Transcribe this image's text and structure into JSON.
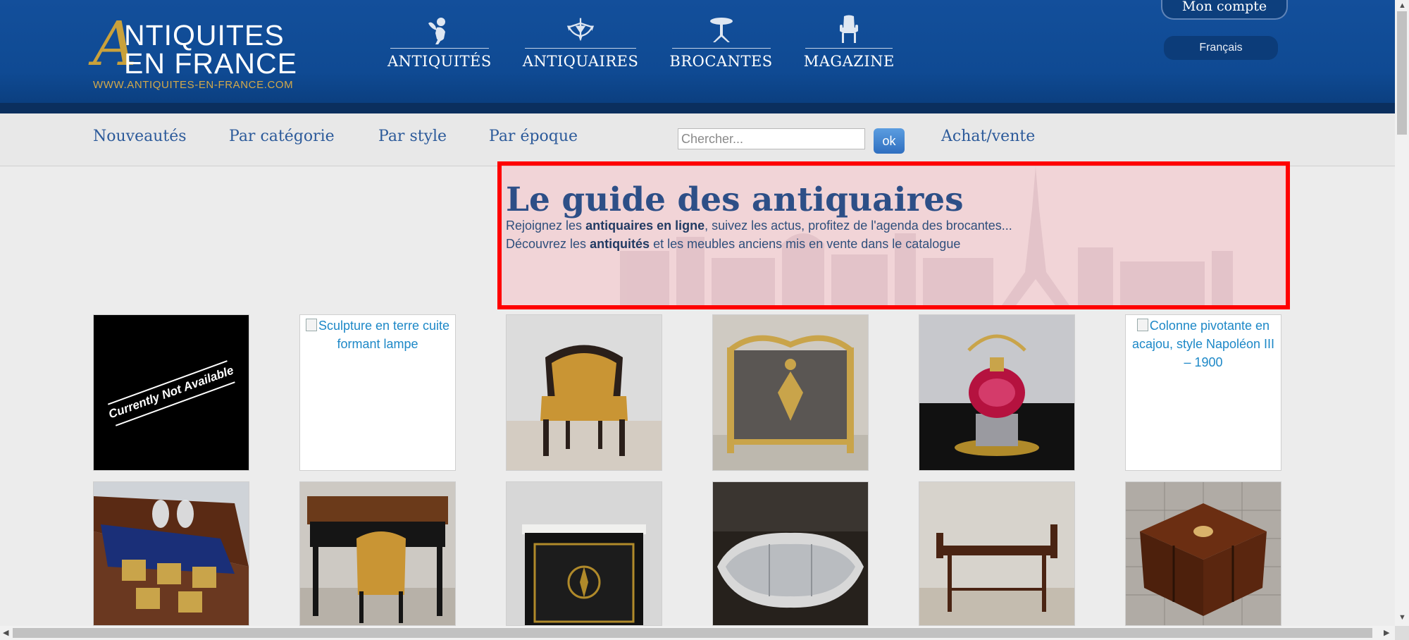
{
  "header": {
    "logo": {
      "letter": "A",
      "line1": "NTIQUITES",
      "line2": "EN FRANCE",
      "url": "WWW.ANTIQUITES-EN-FRANCE.COM"
    },
    "main_nav": [
      {
        "label": "ANTIQUITÉS",
        "icon": "cherub-icon"
      },
      {
        "label": "ANTIQUAIRES",
        "icon": "chandelier-icon"
      },
      {
        "label": "BROCANTES",
        "icon": "gueridon-table-icon"
      },
      {
        "label": "MAGAZINE",
        "icon": "armchair-icon"
      }
    ],
    "account_label": "Mon compte",
    "language_label": "Français"
  },
  "subnav": {
    "links": [
      "Nouveautés",
      "Par catégorie",
      "Par style",
      "Par époque"
    ],
    "search_placeholder": "Chercher...",
    "search_value": "",
    "ok_label": "ok",
    "achat_vente_label": "Achat/vente"
  },
  "hero": {
    "title": "Le guide des antiquaires",
    "line1_pre": "Rejoignez les ",
    "line1_bold": "antiquaires en ligne",
    "line1_post": ", suivez les actus, profitez de l'agenda des brocantes...",
    "line2_pre": "Découvrez les ",
    "line2_bold": "antiquités",
    "line2_post": " et les meubles anciens mis en vente dans le catalogue"
  },
  "products": {
    "row1": [
      {
        "type": "placeholder",
        "label": "Currently Not Available"
      },
      {
        "type": "broken",
        "alt": "Sculpture en terre cuite formant lampe"
      },
      {
        "type": "image",
        "subject": "yellow leather bergere armchair"
      },
      {
        "type": "image",
        "subject": "gilt bronze fire screen"
      },
      {
        "type": "image",
        "subject": "pink glass kettle on silver stand"
      },
      {
        "type": "broken",
        "alt": "Colonne pivotante en acajou, style Napoléon III – 1900"
      }
    ],
    "row2": [
      {
        "type": "image",
        "subject": "liquor cellar box with carafes"
      },
      {
        "type": "image",
        "subject": "Louis XV desk with chair"
      },
      {
        "type": "image",
        "subject": "Napoleon III boulle cabinet"
      },
      {
        "type": "image",
        "subject": "silver table centerpiece surtout"
      },
      {
        "type": "image",
        "subject": "mahogany window bench"
      },
      {
        "type": "image",
        "subject": "revolving mahogany bookcase"
      }
    ]
  },
  "colors": {
    "header_blue": "#134f9b",
    "logo_gold": "#c9a13b",
    "link_blue": "#2c5a9a",
    "hero_border": "#ff0000",
    "alt_text_blue": "#1d88c7"
  }
}
